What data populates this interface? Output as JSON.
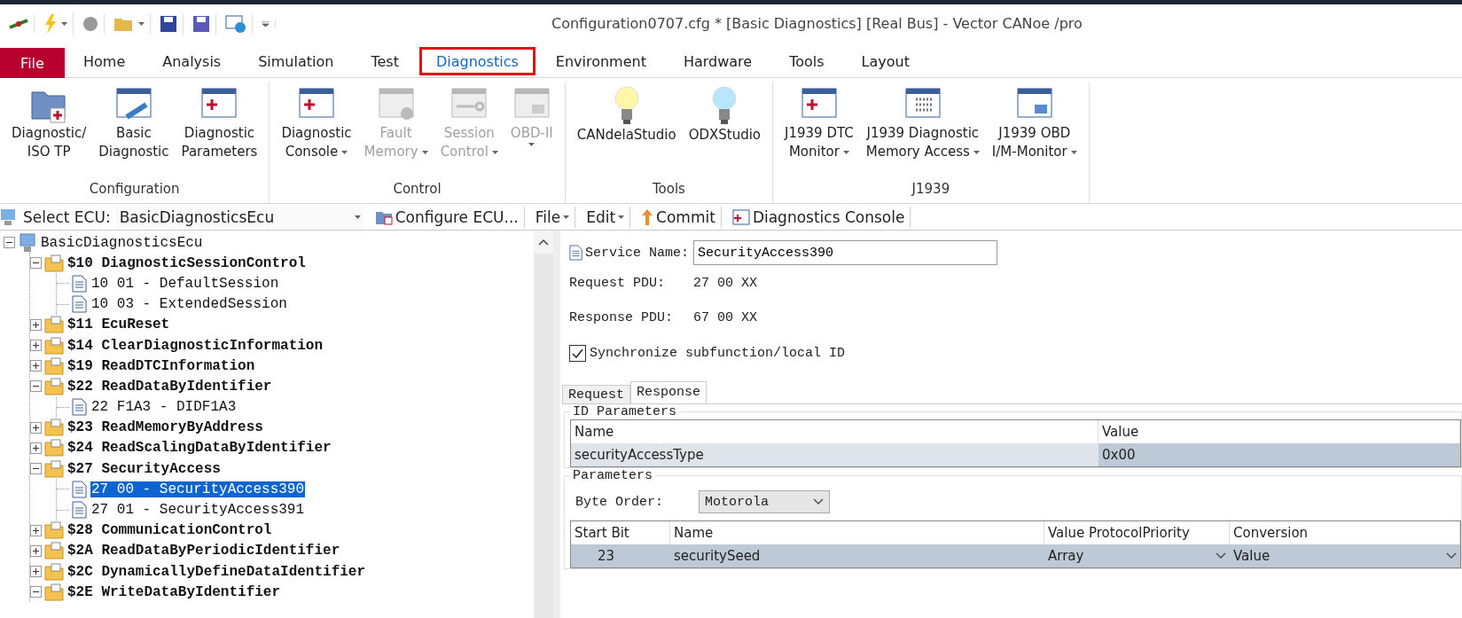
{
  "window": {
    "title": "Configuration0707.cfg * [Basic Diagnostics] [Real Bus] - Vector CANoe /pro"
  },
  "menu_tabs": [
    {
      "label": "File",
      "kind": "file",
      "selected": false
    },
    {
      "label": "Home",
      "kind": "tab",
      "selected": false
    },
    {
      "label": "Analysis",
      "kind": "tab",
      "selected": false
    },
    {
      "label": "Simulation",
      "kind": "tab",
      "selected": false
    },
    {
      "label": "Test",
      "kind": "tab",
      "selected": false
    },
    {
      "label": "Diagnostics",
      "kind": "tab",
      "selected": true
    },
    {
      "label": "Environment",
      "kind": "tab",
      "selected": false
    },
    {
      "label": "Hardware",
      "kind": "tab",
      "selected": false
    },
    {
      "label": "Tools",
      "kind": "tab",
      "selected": false
    },
    {
      "label": "Layout",
      "kind": "tab",
      "selected": false
    }
  ],
  "ribbon_groups": [
    {
      "label": "Configuration",
      "buttons": [
        {
          "lines": [
            "Diagnostic/",
            "ISO TP"
          ],
          "disabled": false,
          "dropdown": false
        },
        {
          "lines": [
            "Basic",
            "Diagnostic"
          ],
          "disabled": false,
          "dropdown": false
        },
        {
          "lines": [
            "Diagnostic",
            "Parameters"
          ],
          "disabled": false,
          "dropdown": false
        }
      ]
    },
    {
      "label": "Control",
      "buttons": [
        {
          "lines": [
            "Diagnostic",
            "Console"
          ],
          "disabled": false,
          "dropdown": true
        },
        {
          "lines": [
            "Fault",
            "Memory"
          ],
          "disabled": true,
          "dropdown": true
        },
        {
          "lines": [
            "Session",
            "Control"
          ],
          "disabled": true,
          "dropdown": true
        },
        {
          "lines": [
            "OBD-II"
          ],
          "disabled": true,
          "dropdown": true
        }
      ]
    },
    {
      "label": "Tools",
      "buttons": [
        {
          "lines": [
            "CANdelaStudio"
          ],
          "disabled": false,
          "dropdown": false
        },
        {
          "lines": [
            "ODXStudio"
          ],
          "disabled": false,
          "dropdown": false
        }
      ]
    },
    {
      "label": "J1939",
      "buttons": [
        {
          "lines": [
            "J1939 DTC",
            "Monitor"
          ],
          "disabled": false,
          "dropdown": true
        },
        {
          "lines": [
            "J1939 Diagnostic",
            "Memory Access"
          ],
          "disabled": false,
          "dropdown": true
        },
        {
          "lines": [
            "J1939 OBD",
            "I/M-Monitor"
          ],
          "disabled": false,
          "dropdown": true
        }
      ]
    }
  ],
  "ecu_toolbar": {
    "label": "Select ECU:",
    "ecu": "BasicDiagnosticsEcu",
    "items": [
      {
        "label": "Configure ECU...",
        "kind": "configure"
      },
      {
        "label": "File",
        "kind": "menu"
      },
      {
        "label": "Edit",
        "kind": "menu"
      },
      {
        "label": "Commit",
        "kind": "commit"
      },
      {
        "label": "Diagnostics Console",
        "kind": "console"
      }
    ]
  },
  "tree": [
    {
      "label": "BasicDiagnosticsEcu",
      "kind": "ecu",
      "expanded": true,
      "children": [
        {
          "label": "$10 DiagnosticSessionControl",
          "kind": "service",
          "expanded": true,
          "children": [
            {
              "label": "10 01 - DefaultSession",
              "kind": "request",
              "selected": false
            },
            {
              "label": "10 03 - ExtendedSession",
              "kind": "request",
              "selected": false
            }
          ]
        },
        {
          "label": "$11 EcuReset",
          "kind": "service",
          "expanded": false
        },
        {
          "label": "$14 ClearDiagnosticInformation",
          "kind": "service",
          "expanded": false
        },
        {
          "label": "$19 ReadDTCInformation",
          "kind": "service",
          "expanded": false
        },
        {
          "label": "$22 ReadDataByIdentifier",
          "kind": "service",
          "expanded": true,
          "children": [
            {
              "label": "22 F1A3 - DIDF1A3",
              "kind": "request",
              "selected": false
            }
          ]
        },
        {
          "label": "$23 ReadMemoryByAddress",
          "kind": "service",
          "expanded": false
        },
        {
          "label": "$24 ReadScalingDataByIdentifier",
          "kind": "service",
          "expanded": false
        },
        {
          "label": "$27 SecurityAccess",
          "kind": "service",
          "expanded": true,
          "children": [
            {
              "label": "27 00 - SecurityAccess390",
              "kind": "request",
              "selected": true
            },
            {
              "label": "27 01 - SecurityAccess391",
              "kind": "request",
              "selected": false
            }
          ]
        },
        {
          "label": "$28 CommunicationControl",
          "kind": "service",
          "expanded": false
        },
        {
          "label": "$2A ReadDataByPeriodicIdentifier",
          "kind": "service",
          "expanded": false
        },
        {
          "label": "$2C DynamicallyDefineDataIdentifier",
          "kind": "service",
          "expanded": false
        },
        {
          "label": "$2E WriteDataByIdentifier",
          "kind": "service",
          "expanded": true
        }
      ]
    }
  ],
  "detail": {
    "service_name_label": "Service Name:",
    "service_name": "SecurityAccess390",
    "pdus": [
      {
        "label": "Request PDU:",
        "value": "27 00 XX"
      },
      {
        "label": "Response PDU:",
        "value": "67 00 XX"
      }
    ],
    "sync_checkbox": {
      "label": "Synchronize subfunction/local ID",
      "checked": true
    },
    "tabs": [
      {
        "label": "Request",
        "selected": false
      },
      {
        "label": "Response",
        "selected": true
      }
    ],
    "id_parameters": {
      "title": "ID Parameters",
      "columns": [
        "Name",
        "Value"
      ],
      "rows": [
        [
          "securityAccessType",
          "0x00"
        ]
      ]
    },
    "parameters": {
      "title": "Parameters",
      "byte_order_label": "Byte Order:",
      "byte_order": "Motorola",
      "columns": [
        "Start Bit",
        "Name",
        "Value ProtocolPriority",
        "Conversion"
      ],
      "rows": [
        [
          "23",
          "securitySeed",
          "Array",
          "Value"
        ]
      ]
    }
  }
}
